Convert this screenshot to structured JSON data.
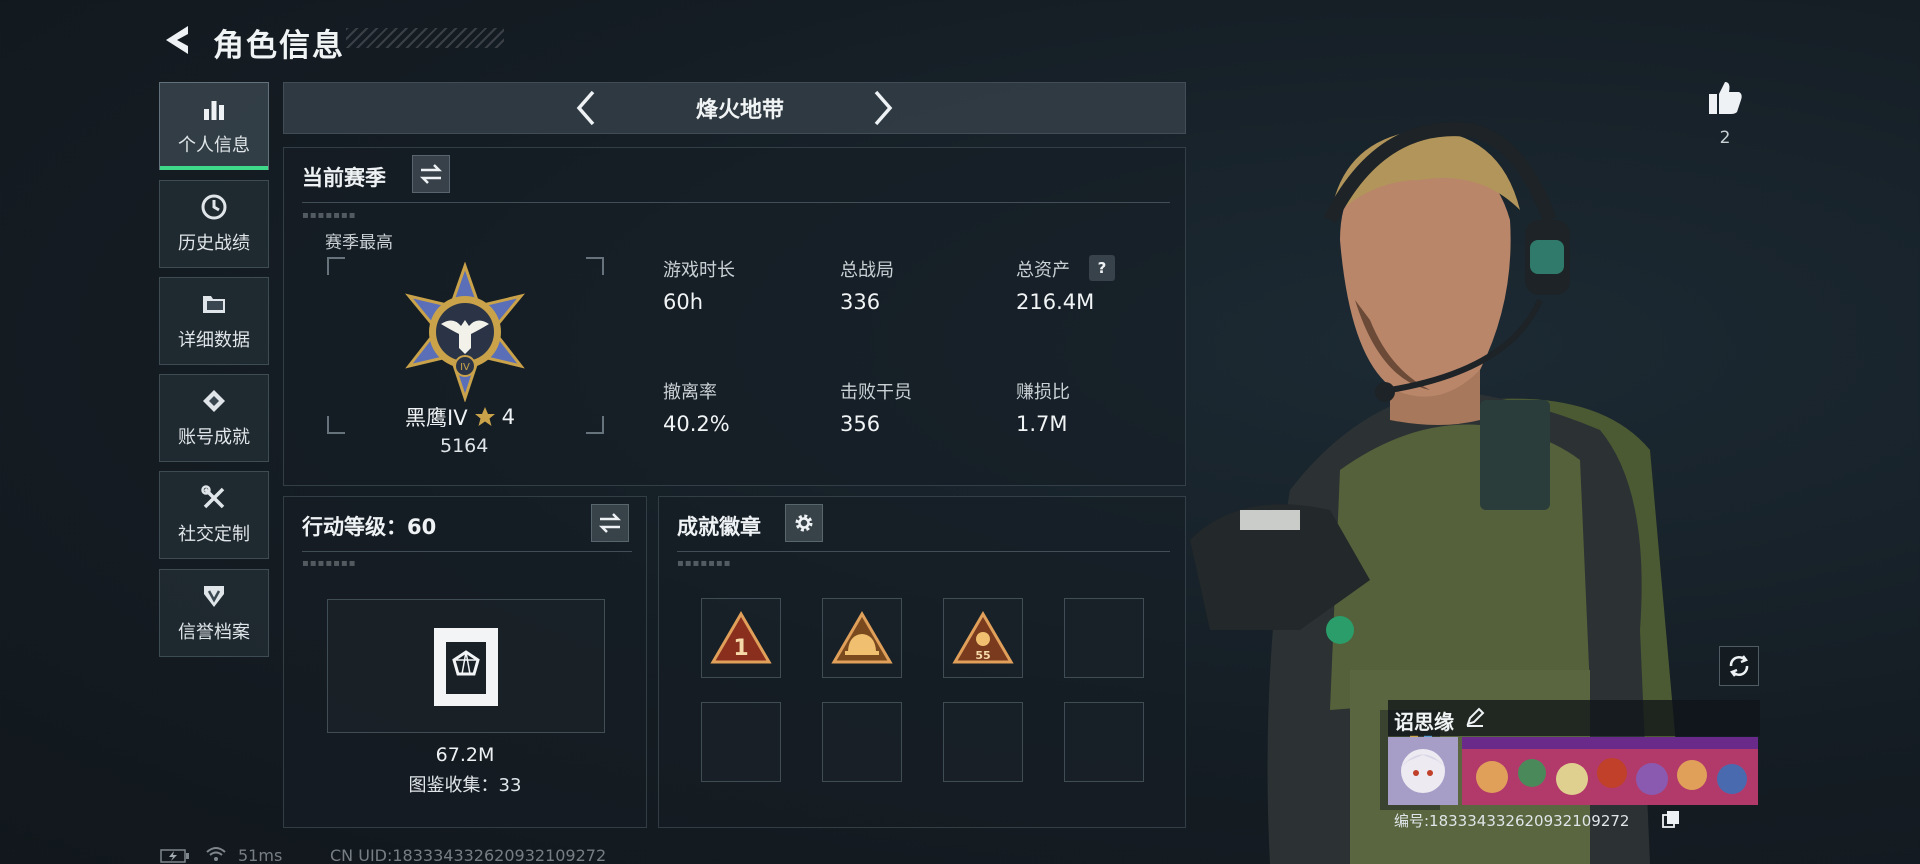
{
  "header": {
    "title": "角色信息"
  },
  "sidebar": {
    "items": [
      {
        "label": "个人信息",
        "icon": "bar-chart-icon",
        "active": true
      },
      {
        "label": "历史战绩",
        "icon": "clock-icon"
      },
      {
        "label": "详细数据",
        "icon": "folder-icon"
      },
      {
        "label": "账号成就",
        "icon": "achievement-icon"
      },
      {
        "label": "社交定制",
        "icon": "wrench-screwdriver-icon"
      },
      {
        "label": "信誉档案",
        "icon": "shield-icon"
      }
    ]
  },
  "mode": {
    "label": "烽火地带"
  },
  "season_panel": {
    "title": "当前赛季",
    "best_label": "赛季最高",
    "rank_name": "黑鹰IV",
    "rank_stars": "4",
    "rank_score": "5164",
    "stats": [
      {
        "label": "游戏时长",
        "value": "60h"
      },
      {
        "label": "总战局",
        "value": "336"
      },
      {
        "label": "总资产",
        "value": "216.4M"
      },
      {
        "label": "撤离率",
        "value": "40.2%"
      },
      {
        "label": "击败干员",
        "value": "356"
      },
      {
        "label": "赚损比",
        "value": "1.7M"
      }
    ],
    "help_glyph": "?"
  },
  "level_panel": {
    "title": "行动等级：60",
    "value": "67.2M",
    "collection": "图鉴收集：33"
  },
  "badges_panel": {
    "title": "成就徽章",
    "badges": [
      {
        "icon": "number-one-triangle-badge",
        "text": "1"
      },
      {
        "icon": "helmet-triangle-badge"
      },
      {
        "icon": "skull-55-triangle-badge",
        "text": "55"
      }
    ]
  },
  "character": {
    "like_count": "2",
    "player_name": "诏思缘",
    "player_id": "编号:1833343326209321092​72"
  },
  "footer": {
    "ping": "51ms",
    "uid": "CN UID:183334332620932109272"
  },
  "colors": {
    "accent": "#3fd98a",
    "rank_gold": "#c9a24a",
    "badge_orange": "#e0a05a"
  }
}
